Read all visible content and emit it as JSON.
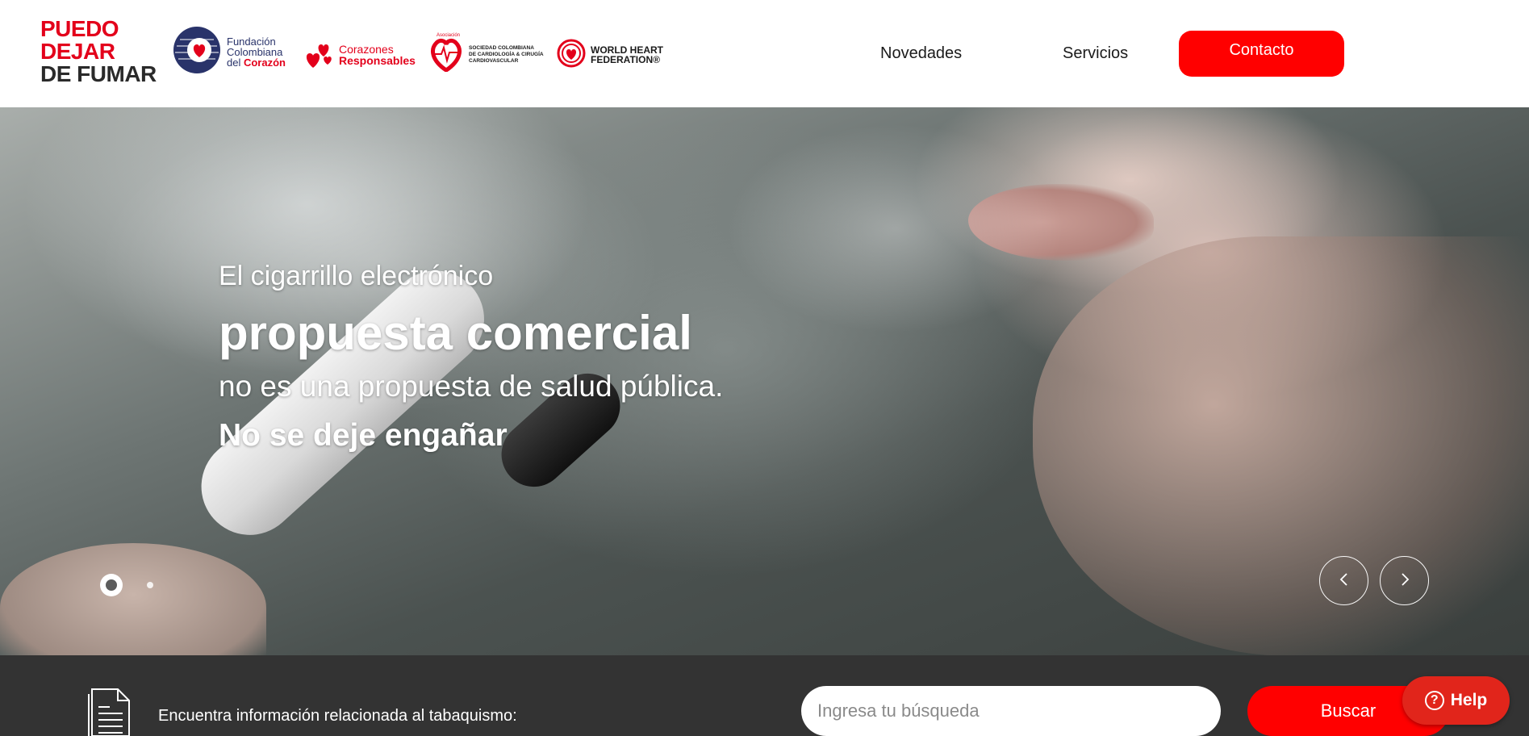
{
  "brand": {
    "line1": "PUEDO",
    "line2": "DEJAR",
    "line3": "DE FUMAR"
  },
  "partners": {
    "fcc": {
      "line1": "Fundación",
      "line2": "Colombiana",
      "line3a": "del ",
      "line3b": "Corazón"
    },
    "cr": {
      "line1": "Corazones",
      "line2": "Responsables"
    },
    "scc": {
      "top": "Asociación",
      "line1": "SOCIEDAD COLOMBIANA",
      "line2": "DE CARDIOLOGÍA & CIRUGÍA",
      "line3": "CARDIOVASCULAR"
    },
    "whf": {
      "line1": "WORLD HEART",
      "line2": "FEDERATION®"
    }
  },
  "nav": {
    "novedades": "Novedades",
    "servicios": "Servicios",
    "contacto": "Contacto"
  },
  "hero": {
    "line1": "El cigarrillo electrónico",
    "line2": "propuesta comercial",
    "line3": "no es una propuesta de salud pública.",
    "line4": "No se deje engañar",
    "slides_total": 2,
    "active_slide": 1
  },
  "search": {
    "label": "Encuentra información relacionada al tabaquismo:",
    "placeholder": "Ingresa tu búsqueda",
    "value": "",
    "button": "Buscar"
  },
  "help": {
    "label": "Help"
  },
  "colors": {
    "brand_red": "#ff0000",
    "dark_band": "#333333",
    "help_red": "#e1251b"
  },
  "icons": [
    "heart-logo-icon",
    "hearts-icon",
    "heart-ecg-icon",
    "whf-heart-icon",
    "chevron-left-icon",
    "chevron-right-icon",
    "document-icon",
    "question-circle-icon"
  ]
}
